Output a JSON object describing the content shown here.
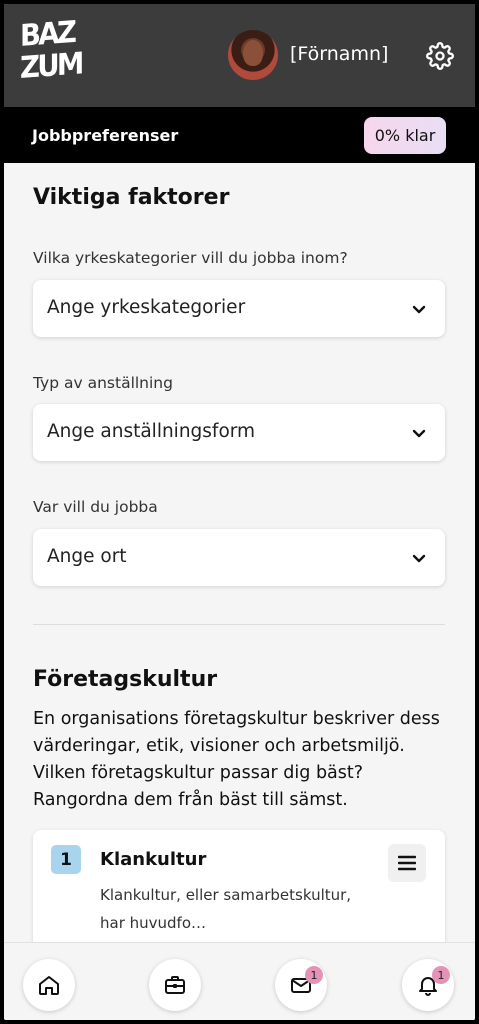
{
  "header": {
    "logo_line1": "BAZ",
    "logo_line2": "ZUM",
    "username": "[Förnamn]"
  },
  "subheader": {
    "title": "Jobbpreferenser",
    "progress": "0% klar"
  },
  "sections": {
    "important": {
      "title": "Viktiga faktorer",
      "fields": [
        {
          "label": "Vilka yrkeskategorier vill du jobba inom?",
          "placeholder": "Ange yrkeskategorier"
        },
        {
          "label": "Typ av anställning",
          "placeholder": "Ange anställningsform"
        },
        {
          "label": "Var vill du jobba",
          "placeholder": "Ange ort"
        }
      ]
    },
    "culture": {
      "title": "Företagskultur",
      "description": "En organisations företagskultur beskriver dess värderingar, etik, visioner och arbetsmiljö. Vilken företagskultur passar dig bäst? Rangordna dem från bäst till sämst.",
      "cards": [
        {
          "rank": "1",
          "title": "Klankultur",
          "description": "Klankultur, eller samarbetskultur, har huvudfo…"
        }
      ]
    }
  },
  "bottom_nav": {
    "items": [
      {
        "icon": "home-icon"
      },
      {
        "icon": "briefcase-icon"
      },
      {
        "icon": "mail-icon",
        "badge": "1"
      },
      {
        "icon": "bell-icon",
        "badge": "1"
      }
    ]
  },
  "colors": {
    "topbar": "#3c3c3c",
    "subbar": "#000000",
    "rank_bg": "#a8d4ee",
    "badge_bg": "#e592b8"
  }
}
